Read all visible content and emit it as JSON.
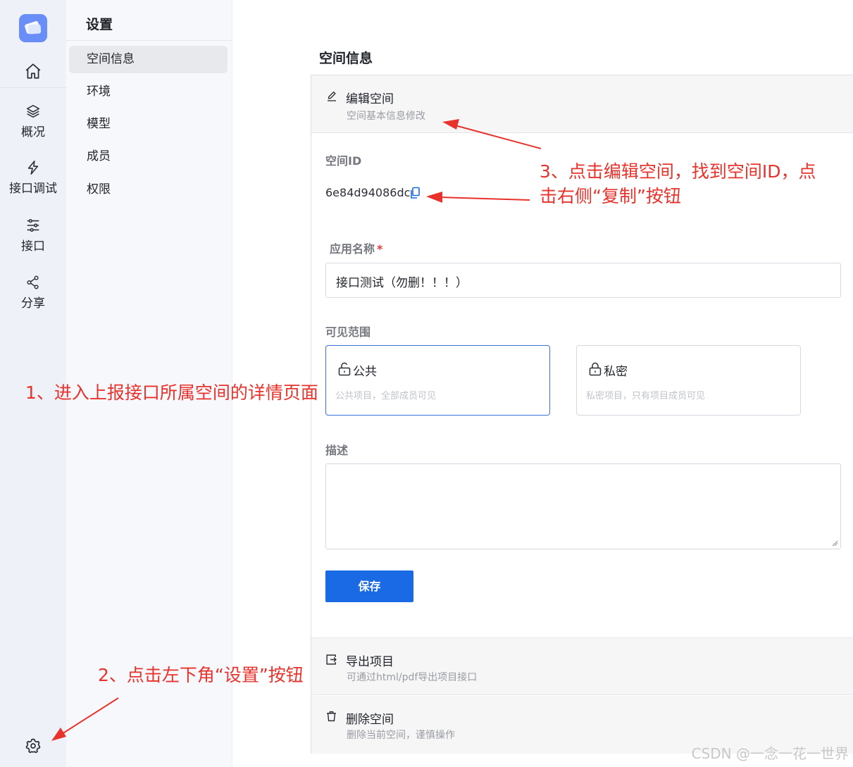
{
  "rail": {
    "items": [
      {
        "label": "",
        "icon": "home-icon"
      },
      {
        "label": "概况",
        "icon": "layers-icon"
      },
      {
        "label": "接口调试",
        "icon": "lightning-icon"
      },
      {
        "label": "接口",
        "icon": "sliders-icon"
      },
      {
        "label": "分享",
        "icon": "share-icon"
      }
    ],
    "settings_icon": "gear-icon"
  },
  "subnav": {
    "title": "设置",
    "items": [
      "空间信息",
      "环境",
      "模型",
      "成员",
      "权限"
    ],
    "active": "空间信息"
  },
  "main": {
    "page_title": "空间信息",
    "edit_section": {
      "title": "编辑空间",
      "desc": "空间基本信息修改"
    },
    "space_id": {
      "label": "空间ID",
      "value": "6e84d94086dc"
    },
    "app_name": {
      "label": "应用名称",
      "required_mark": "*",
      "value": "接口测试（勿删！！！）"
    },
    "visibility": {
      "label": "可见范围",
      "options": [
        {
          "title": "公共",
          "desc": "公共项目，全部成员可见",
          "selected": true
        },
        {
          "title": "私密",
          "desc": "私密项目，只有项目成员可见",
          "selected": false
        }
      ]
    },
    "description": {
      "label": "描述",
      "value": ""
    },
    "save_label": "保存",
    "export_section": {
      "title": "导出项目",
      "desc": "可通过html/pdf导出项目接口"
    },
    "delete_section": {
      "title": "删除空间",
      "desc": "删除当前空间，谨慎操作"
    }
  },
  "annotations": {
    "step1": "1、进入上报接口所属空间的详情页面",
    "step2": "2、点击左下角“设置”按钮",
    "step3_line1": "3、点击编辑空间，找到空间ID，点",
    "step3_line2": "击右侧“复制”按钮"
  },
  "watermark": "CSDN @一念一花一世界",
  "colors": {
    "accent": "#1a6ae5",
    "annotation": "#e8322c",
    "rail_bg": "#eef1f8"
  }
}
